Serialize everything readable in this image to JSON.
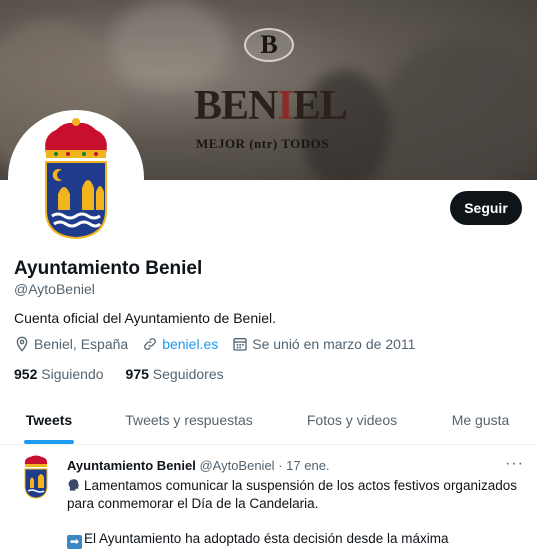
{
  "banner": {
    "logo_letter": "B",
    "brand_pre": "B",
    "brand_mid": "EN",
    "brand_i": "I",
    "brand_post": "EL",
    "tagline": "MEJOR (ntr) TODOS"
  },
  "profile": {
    "follow_label": "Seguir",
    "name": "Ayuntamiento Beniel",
    "handle": "@AytoBeniel",
    "bio": "Cuenta oficial del Ayuntamiento de Beniel.",
    "location": "Beniel, España",
    "website": "beniel.es",
    "joined": "Se unió en marzo de 2011",
    "following_count": "952",
    "following_label": "Siguiendo",
    "followers_count": "975",
    "followers_label": "Seguidores"
  },
  "tabs": [
    {
      "label": "Tweets",
      "active": true
    },
    {
      "label": "Tweets y respuestas",
      "active": false
    },
    {
      "label": "Fotos y videos",
      "active": false
    },
    {
      "label": "Me gusta",
      "active": false
    }
  ],
  "tweet": {
    "author": "Ayuntamiento Beniel",
    "handle": "@AytoBeniel",
    "sep": "·",
    "date": "17 ene.",
    "more": "···",
    "line1": "Lamentamos comunicar la suspensión de los actos festivos organizados para conmemorar el Día de la Candelaria.",
    "line2": "El Ayuntamiento ha adoptado ésta decisión desde la máxima"
  },
  "colors": {
    "accent": "#1d9bf0",
    "text": "#0f1419",
    "muted": "#536471",
    "shield_blue": "#1f3b8c",
    "shield_gold": "#f2b41c",
    "crown_red": "#c8102e"
  },
  "icons": [
    "location-icon",
    "link-icon",
    "calendar-icon",
    "more-icon",
    "speaking-head-icon",
    "right-arrow-icon"
  ]
}
